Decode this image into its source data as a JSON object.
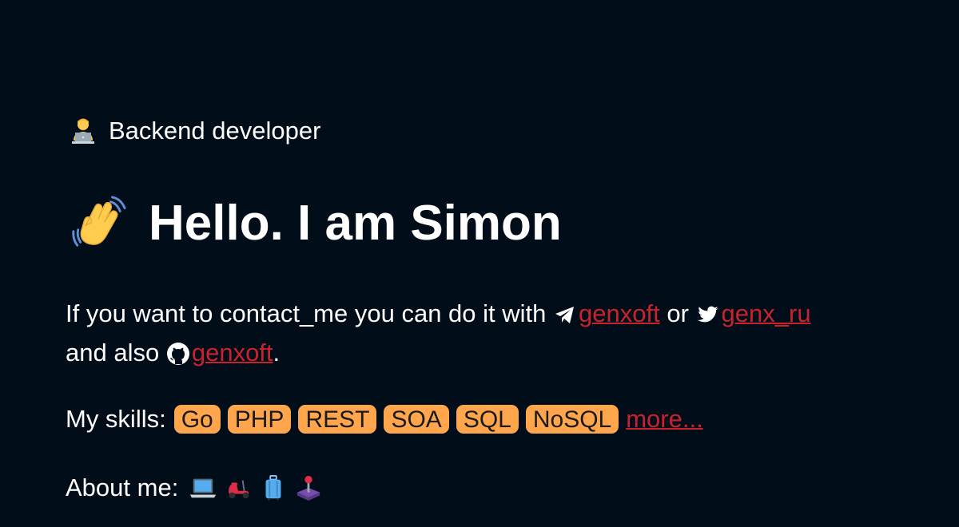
{
  "role": {
    "emoji": "technologist-emoji",
    "text": "Backend developer"
  },
  "greeting": {
    "emoji": "waving-hand-emoji",
    "text": "Hello. I am Simon"
  },
  "contact": {
    "intro": "If you want to contact_me you can do it with",
    "telegram": {
      "icon": "telegram-icon",
      "label": "genxoft"
    },
    "or_text": "or",
    "twitter": {
      "icon": "twitter-icon",
      "label": "genx_ru"
    },
    "and_also_text": "and also",
    "github": {
      "icon": "github-icon",
      "label": "genxoft"
    },
    "end_punct": "."
  },
  "skills": {
    "label": "My skills:",
    "tags": [
      "Go",
      "PHP",
      "REST",
      "SOA",
      "SQL",
      "NoSQL"
    ],
    "more_label": "more..."
  },
  "about": {
    "label": "About me:",
    "emojis": [
      "laptop-emoji",
      "motor-scooter-emoji",
      "luggage-emoji",
      "joystick-emoji"
    ]
  },
  "colors": {
    "background": "#010d19",
    "text": "#ffffff",
    "link": "#c8232c",
    "tag_bg": "#ffa64d"
  }
}
